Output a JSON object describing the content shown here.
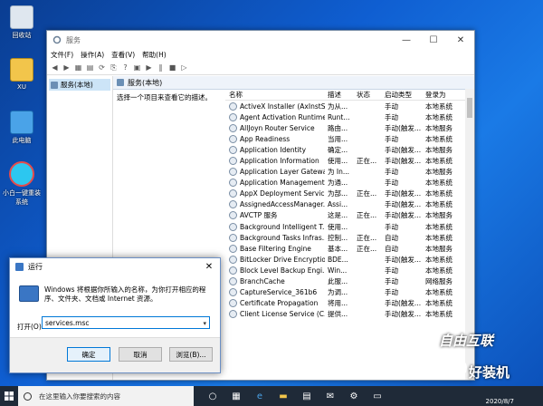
{
  "desktop": {
    "icons": [
      {
        "label": "回收站"
      },
      {
        "label": "XU"
      },
      {
        "label": "此电脑"
      },
      {
        "label": "小白一键重装系统"
      }
    ]
  },
  "services_window": {
    "title": "服务",
    "menu": [
      "文件(F)",
      "操作(A)",
      "查看(V)",
      "帮助(H)"
    ],
    "tree_node": "服务(本地)",
    "right_header": "服务(本地)",
    "description": "选择一个项目来查看它的描述。",
    "columns": [
      "名称",
      "描述",
      "状态",
      "启动类型",
      "登录为"
    ],
    "rows": [
      [
        "ActiveX Installer (AxInstSV)",
        "为从...",
        "",
        "手动",
        "本地系统"
      ],
      [
        "Agent Activation Runtime...",
        "Runt...",
        "",
        "手动",
        "本地系统"
      ],
      [
        "AllJoyn Router Service",
        "路由...",
        "",
        "手动(触发...",
        "本地服务"
      ],
      [
        "App Readiness",
        "当用...",
        "",
        "手动",
        "本地系统"
      ],
      [
        "Application Identity",
        "确定...",
        "",
        "手动(触发...",
        "本地服务"
      ],
      [
        "Application Information",
        "使用...",
        "正在...",
        "手动(触发...",
        "本地系统"
      ],
      [
        "Application Layer Gatewa...",
        "为 In...",
        "",
        "手动",
        "本地服务"
      ],
      [
        "Application Management",
        "为通...",
        "",
        "手动",
        "本地系统"
      ],
      [
        "AppX Deployment Servic...",
        "为部...",
        "正在...",
        "手动(触发...",
        "本地系统"
      ],
      [
        "AssignedAccessManager...",
        "Assi...",
        "",
        "手动(触发...",
        "本地系统"
      ],
      [
        "AVCTP 服务",
        "这是...",
        "正在...",
        "手动(触发...",
        "本地服务"
      ],
      [
        "Background Intelligent T...",
        "使用...",
        "",
        "手动",
        "本地系统"
      ],
      [
        "Background Tasks Infras...",
        "控制...",
        "正在...",
        "自动",
        "本地系统"
      ],
      [
        "Base Filtering Engine",
        "基本...",
        "正在...",
        "自动",
        "本地服务"
      ],
      [
        "BitLocker Drive Encryptio...",
        "BDE...",
        "",
        "手动(触发...",
        "本地系统"
      ],
      [
        "Block Level Backup Engi...",
        "Win...",
        "",
        "手动",
        "本地系统"
      ],
      [
        "BranchCache",
        "此服...",
        "",
        "手动",
        "网络服务"
      ],
      [
        "CaptureService_361b6",
        "为调...",
        "",
        "手动",
        "本地系统"
      ],
      [
        "Certificate Propagation",
        "将用...",
        "",
        "手动(触发...",
        "本地系统"
      ],
      [
        "Client License Service (C...",
        "提供...",
        "",
        "手动(触发...",
        "本地系统"
      ]
    ]
  },
  "run_dialog": {
    "title": "运行",
    "description": "Windows 将根据你所输入的名称，为你打开相应的程序、文件夹、文档或 Internet 资源。",
    "open_label": "打开(O):",
    "command_value": "services.msc",
    "ok_label": "确定",
    "cancel_label": "取消",
    "browse_label": "浏览(B)..."
  },
  "taskbar": {
    "search_placeholder": "在这里输入你要搜索的内容",
    "date": "2020/8/7"
  },
  "watermarks": {
    "top": "自由互联",
    "bottom": "好装机"
  }
}
